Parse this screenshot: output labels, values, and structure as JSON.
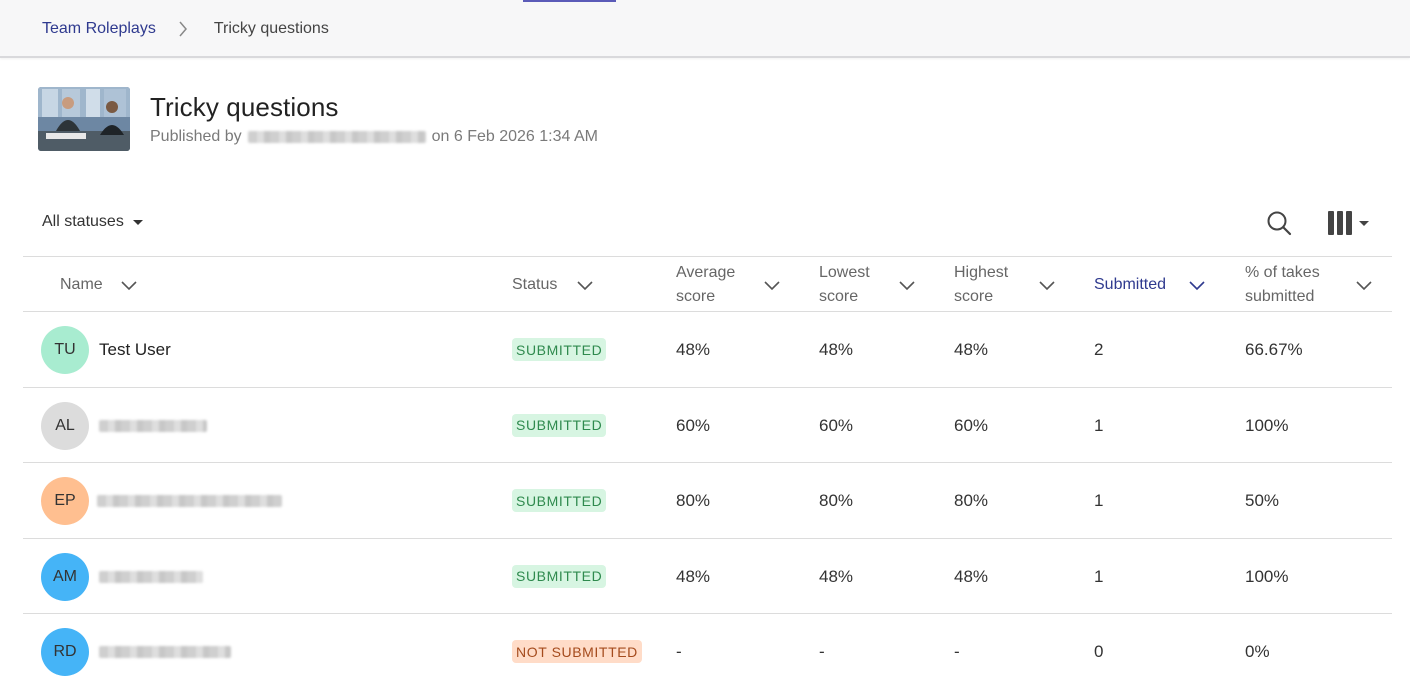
{
  "breadcrumb": {
    "parent": "Team Roleplays",
    "current": "Tricky questions"
  },
  "header": {
    "title": "Tricky questions",
    "published_prefix": "Published by",
    "published_suffix": "on 6 Feb 2026 1:34 AM"
  },
  "toolbar": {
    "filter_label": "All statuses"
  },
  "columns": {
    "name": "Name",
    "status": "Status",
    "average": "Average score",
    "lowest": "Lowest score",
    "highest": "Highest score",
    "submitted": "Submitted",
    "percent": "% of takes submitted"
  },
  "rows": [
    {
      "initials": "TU",
      "name": "Test User",
      "status": "SUBMITTED",
      "average": "48%",
      "lowest": "48%",
      "highest": "48%",
      "submitted": "2",
      "percent": "66.67%"
    },
    {
      "initials": "AL",
      "status": "SUBMITTED",
      "average": "60%",
      "lowest": "60%",
      "highest": "60%",
      "submitted": "1",
      "percent": "100%"
    },
    {
      "initials": "EP",
      "status": "SUBMITTED",
      "average": "80%",
      "lowest": "80%",
      "highest": "80%",
      "submitted": "1",
      "percent": "50%"
    },
    {
      "initials": "AM",
      "status": "SUBMITTED",
      "average": "48%",
      "lowest": "48%",
      "highest": "48%",
      "submitted": "1",
      "percent": "100%"
    },
    {
      "initials": "RD",
      "status": "NOT SUBMITTED",
      "average": "-",
      "lowest": "-",
      "highest": "-",
      "submitted": "0",
      "percent": "0%"
    }
  ],
  "colors": {
    "accent": "#2f3a8f",
    "avatar_tu": "#a8ecd0",
    "avatar_al": "#dcdcdc",
    "avatar_ep": "#ffbf90",
    "avatar_am": "#45b4f7",
    "avatar_rd": "#45b4f7",
    "submitted_bg": "#d7f5e2",
    "not_submitted_bg": "#ffdcc8"
  }
}
